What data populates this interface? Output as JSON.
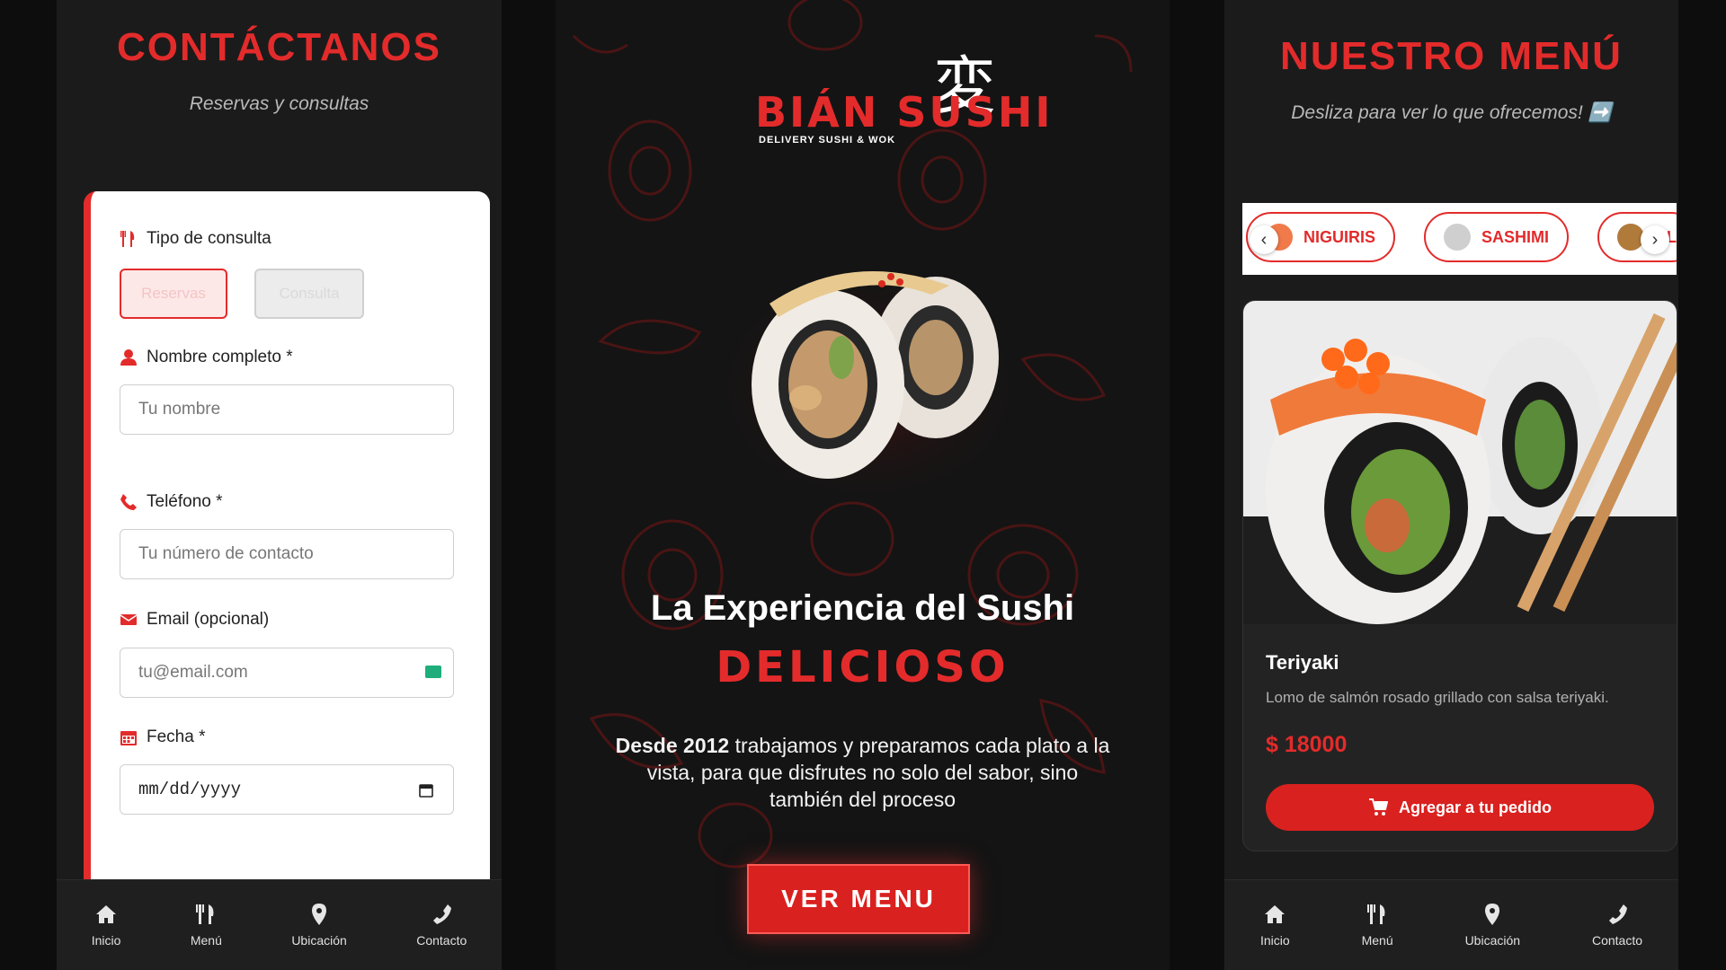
{
  "contact_screen": {
    "title": "CONTÁCTANOS",
    "subtitle": "Reservas y consultas",
    "form": {
      "consult_type_label": "Tipo de consulta",
      "consult_options": [
        "Reservas",
        "Consulta"
      ],
      "name_label": "Nombre completo *",
      "name_placeholder": "Tu nombre",
      "phone_label": "Teléfono *",
      "phone_placeholder": "Tu número de contacto",
      "email_label": "Email (opcional)",
      "email_placeholder": "tu@email.com",
      "date_label": "Fecha *",
      "date_placeholder": "mm/dd/yyyy"
    }
  },
  "home_screen": {
    "logo_kanji": "変",
    "logo_name": "BIÁN SUSHI",
    "logo_tagline": "DELIVERY SUSHI & WOK",
    "headline": "La Experiencia del Sushi",
    "headline_accent": "DELICIOSO",
    "desc_bold": "Desde 2012",
    "desc_rest": " trabajamos y preparamos cada plato a la vista, para que disfrutes no solo del sabor, sino también del proceso",
    "cta": "VER MENU"
  },
  "menu_screen": {
    "title": "NUESTRO MENÚ",
    "subtitle": "Desliza para ver lo que ofrecemos! ➡️",
    "categories": [
      "NIGUIRIS",
      "SASHIMI",
      "AL"
    ],
    "product": {
      "name": "Teriyaki",
      "description": "Lomo de salmón rosado grillado con salsa teriyaki.",
      "price": "$ 18000",
      "button": "Agregar a tu pedido"
    }
  },
  "bottom_nav": {
    "items": [
      "Inicio",
      "Menú",
      "Ubicación",
      "Contacto"
    ]
  },
  "colors": {
    "accent": "#e32b2b",
    "bg": "#1b1b1b"
  }
}
